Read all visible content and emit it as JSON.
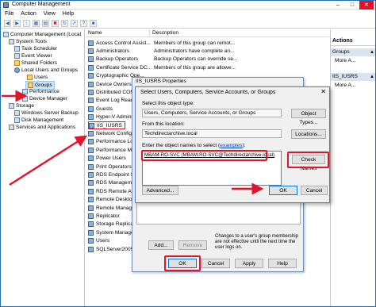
{
  "window": {
    "title": "Computer Management"
  },
  "menu": [
    "File",
    "Action",
    "View",
    "Help"
  ],
  "tree": [
    {
      "label": "Computer Management (Local",
      "icon": "computer-icon"
    },
    {
      "label": "System Tools",
      "icon": "tools-icon"
    },
    {
      "label": "Task Scheduler",
      "icon": "clock-icon"
    },
    {
      "label": "Event Viewer",
      "icon": "event-icon"
    },
    {
      "label": "Shared Folders",
      "icon": "folder-icon"
    },
    {
      "label": "Local Users and Groups",
      "icon": "users-icon"
    },
    {
      "label": "Users",
      "icon": "folder-icon"
    },
    {
      "label": "Groups",
      "icon": "folder-icon"
    },
    {
      "label": "Performance",
      "icon": "performance-icon"
    },
    {
      "label": "Device Manager",
      "icon": "device-icon"
    },
    {
      "label": "Storage",
      "icon": "storage-icon"
    },
    {
      "label": "Windows Server Backup",
      "icon": "backup-icon"
    },
    {
      "label": "Disk Management",
      "icon": "disk-icon"
    },
    {
      "label": "Services and Applications",
      "icon": "services-icon"
    }
  ],
  "list": {
    "col_name": "Name",
    "col_desc": "Description",
    "rows": [
      {
        "name": "Access Control Assist...",
        "desc": "Members of this group can remot..."
      },
      {
        "name": "Administrators",
        "desc": "Administrators have complete an..."
      },
      {
        "name": "Backup Operators",
        "desc": "Backup Operators can override se..."
      },
      {
        "name": "Certificate Service DC...",
        "desc": "Members of this group are allowe..."
      },
      {
        "name": "Cryptographic Ope...",
        "desc": ""
      },
      {
        "name": "Device Owners",
        "desc": ""
      },
      {
        "name": "Distributed COM...",
        "desc": ""
      },
      {
        "name": "Event Log Readers",
        "desc": ""
      },
      {
        "name": "Guests",
        "desc": ""
      },
      {
        "name": "Hyper-V Administ...",
        "desc": ""
      },
      {
        "name": "IIS_IUSRS",
        "desc": ""
      },
      {
        "name": "Network Config...",
        "desc": ""
      },
      {
        "name": "Performance Log...",
        "desc": ""
      },
      {
        "name": "Performance Mon...",
        "desc": ""
      },
      {
        "name": "Power Users",
        "desc": ""
      },
      {
        "name": "Print Operators",
        "desc": ""
      },
      {
        "name": "RDS Endpoint Ser...",
        "desc": ""
      },
      {
        "name": "RDS Management...",
        "desc": ""
      },
      {
        "name": "RDS Remote Acce...",
        "desc": ""
      },
      {
        "name": "Remote Desktop...",
        "desc": ""
      },
      {
        "name": "Remote Manage...",
        "desc": ""
      },
      {
        "name": "Replicator",
        "desc": ""
      },
      {
        "name": "Storage Replica A...",
        "desc": ""
      },
      {
        "name": "System Managed...",
        "desc": ""
      },
      {
        "name": "Users",
        "desc": ""
      },
      {
        "name": "SQLServer2005SQ...",
        "desc": ""
      }
    ]
  },
  "actions": {
    "header": "Actions",
    "sec1": "Groups",
    "item1": "More A...",
    "sec2": "IIS_IUSRS",
    "item2": "More A..."
  },
  "props": {
    "title": "IIS_IUSRS Properties",
    "add": "Add...",
    "remove": "Remove",
    "note": "Changes to a user's group membership are not effective until the next time the user logs on.",
    "ok": "OK",
    "cancel": "Cancel",
    "apply": "Apply",
    "help": "Help"
  },
  "dialog": {
    "title": "Select Users, Computers, Service Accounts, or Groups",
    "object_type_label": "Select this object type:",
    "object_type_value": "Users, Computers, Service Accounts, or Groups",
    "object_types_btn": "Object Types...",
    "location_label": "From this location:",
    "location_value": "Techdirectarchive.local",
    "locations_btn": "Locations...",
    "names_label_pre": "Enter the object names to select (",
    "names_label_link": "examples",
    "names_label_post": "):",
    "names_value": "MBAM-RO-SVC (MBAM-RO-SVC@Techdirectarchive.local)",
    "check_names_btn": "Check Names",
    "advanced_btn": "Advanced...",
    "ok_btn": "OK",
    "cancel_btn": "Cancel"
  },
  "colors": {
    "highlight": "#e0142a",
    "selection": "#cce4f7",
    "accent": "#0078d7"
  }
}
